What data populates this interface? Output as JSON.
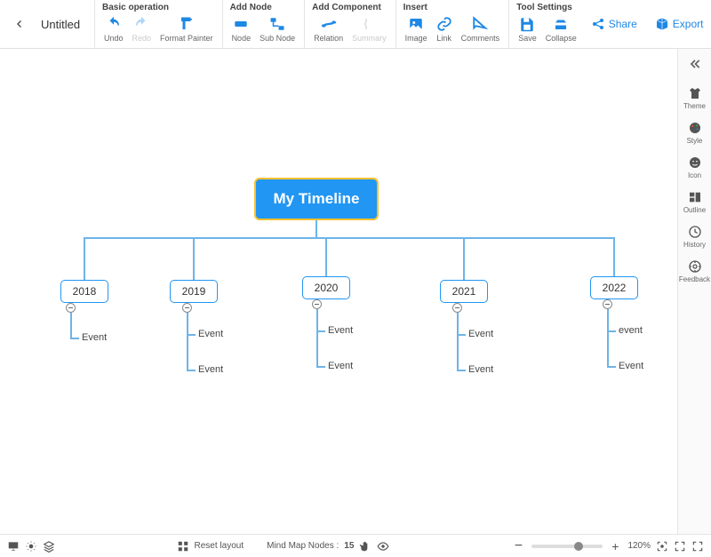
{
  "header": {
    "title": "Untitled",
    "actions": {
      "share": "Share",
      "export": "Export"
    },
    "groups": {
      "basic": {
        "title": "Basic operation",
        "undo": "Undo",
        "redo": "Redo",
        "format_painter": "Format Painter"
      },
      "add_node": {
        "title": "Add Node",
        "node": "Node",
        "sub_node": "Sub Node"
      },
      "add_component": {
        "title": "Add Component",
        "relation": "Relation",
        "summary": "Summary"
      },
      "insert": {
        "title": "Insert",
        "image": "Image",
        "link": "Link",
        "comments": "Comments"
      },
      "tool": {
        "title": "Tool Settings",
        "save": "Save",
        "collapse": "Collapse"
      }
    }
  },
  "side": {
    "theme": "Theme",
    "style": "Style",
    "icon": "Icon",
    "outline": "Outline",
    "history": "History",
    "feedback": "Feedback"
  },
  "bottom": {
    "reset_layout": "Reset layout",
    "node_count_label": "Mind Map Nodes :",
    "node_count": "15",
    "zoom": "120%"
  },
  "chart_data": {
    "type": "tree",
    "root": "My Timeline",
    "years": [
      {
        "label": "2018",
        "events": [
          "Event"
        ]
      },
      {
        "label": "2019",
        "events": [
          "Event",
          "Event"
        ]
      },
      {
        "label": "2020",
        "events": [
          "Event",
          "Event"
        ]
      },
      {
        "label": "2021",
        "events": [
          "Event",
          "Event"
        ]
      },
      {
        "label": "2022",
        "events": [
          "event",
          "Event"
        ]
      }
    ]
  }
}
